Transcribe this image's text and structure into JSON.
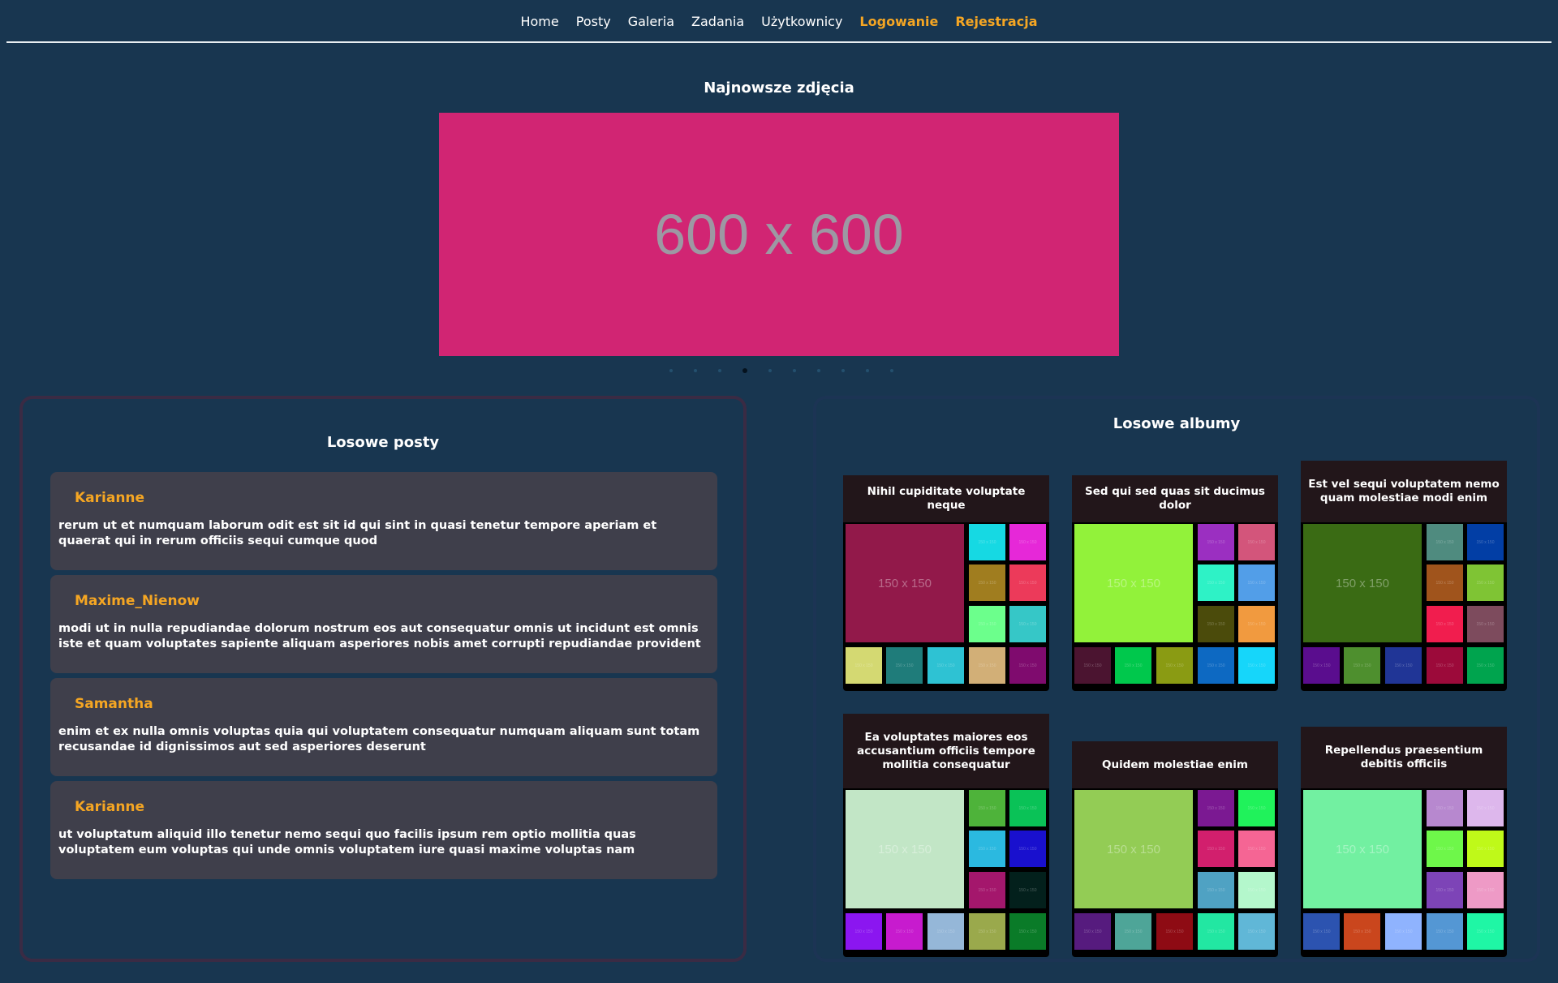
{
  "nav": {
    "items": [
      "Home",
      "Posty",
      "Galeria",
      "Zadania",
      "Użytkownicy"
    ],
    "login": "Logowanie",
    "register": "Rejestracja"
  },
  "carousel": {
    "title": "Najnowsze zdjęcia",
    "placeholder": "600 x 600",
    "dots": 10,
    "active_index": 3
  },
  "posts": {
    "title": "Losowe posty",
    "items": [
      {
        "author": "Karianne",
        "body": "rerum ut et numquam laborum odit est sit id qui sint in quasi tenetur tempore aperiam et quaerat qui in rerum officiis sequi cumque quod"
      },
      {
        "author": "Maxime_Nienow",
        "body": "modi ut in nulla repudiandae dolorum nostrum eos aut consequatur omnis ut incidunt est omnis iste et quam voluptates sapiente aliquam asperiores nobis amet corrupti repudiandae provident"
      },
      {
        "author": "Samantha",
        "body": "enim et ex nulla omnis voluptas quia qui voluptatem consequatur numquam aliquam sunt totam recusandae id dignissimos aut sed asperiores deserunt"
      },
      {
        "author": "Karianne",
        "body": "ut voluptatum aliquid illo tenetur nemo sequi quo facilis ipsum rem optio mollitia quas voluptatem eum voluptas qui unde omnis voluptatem iure quasi maxime voluptas nam"
      }
    ]
  },
  "albums": {
    "title": "Losowe albumy",
    "tile_label": "150 x 150",
    "items": [
      {
        "title": "Nihil cupiditate voluptate neque",
        "colors": [
          "#92194a",
          "#16d9e3",
          "#e628d8",
          "#a07d1f",
          "#ec3a5a",
          "#6cff8c",
          "#36c7c7",
          "#d4d972",
          "#1f7c7a",
          "#2ec2d3",
          "#d2af77",
          "#7f0b6e"
        ]
      },
      {
        "title": "Sed qui sed quas sit ducimus dolor",
        "colors": [
          "#92f23a",
          "#9b2fc1",
          "#d3557b",
          "#2ef2c6",
          "#529ee8",
          "#4b4b0b",
          "#f19a3f",
          "#4b1430",
          "#00c84c",
          "#8a9b13",
          "#0d69c2",
          "#16d6fa"
        ]
      },
      {
        "title": "Est vel sequi voluptatem nemo quam molestiae modi enim",
        "colors": [
          "#3a6b14",
          "#4f8b7f",
          "#023ea5",
          "#a0541c",
          "#7fc434",
          "#f11d4e",
          "#7d4b5d",
          "#5a0d8e",
          "#4e8f2e",
          "#203596",
          "#9c0a3a",
          "#00a44e"
        ]
      },
      {
        "title": "Ea voluptates maiores eos accusantium officiis tempore mollitia consequatur",
        "colors": [
          "#c2e6c6",
          "#4eb33a",
          "#0ac257",
          "#2bb9e0",
          "#1910ce",
          "#a4176c",
          "#03201c",
          "#8b16f0",
          "#c71bce",
          "#95b7d8",
          "#9aa94c",
          "#0a7b28"
        ]
      },
      {
        "title": "Quidem molestiae enim",
        "colors": [
          "#93cc55",
          "#7b1992",
          "#20f25b",
          "#d21f6d",
          "#f56594",
          "#4fa2c3",
          "#b4f7cc",
          "#561b7e",
          "#4ea598",
          "#8e0b14",
          "#22e7a2",
          "#60b7d7"
        ]
      },
      {
        "title": "Repellendus praesentium debitis officiis",
        "colors": [
          "#72f0a1",
          "#b788cf",
          "#ddb7ec",
          "#6ef74a",
          "#bff919",
          "#7d44b7",
          "#ee9ac6",
          "#2c53b0",
          "#ca461d",
          "#8fb3fe",
          "#5497d4",
          "#1ff6a5"
        ]
      }
    ]
  }
}
